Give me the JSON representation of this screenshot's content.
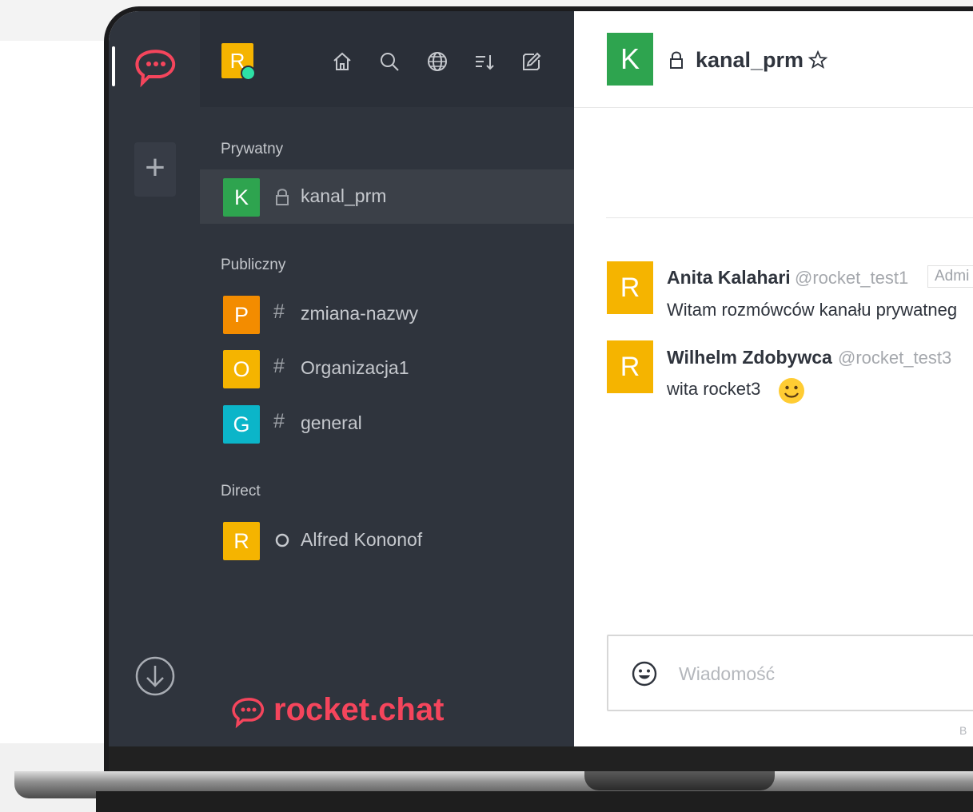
{
  "sidebar": {
    "avatar_letter": "R",
    "sections": {
      "private": "Prywatny",
      "public": "Publiczny",
      "direct": "Direct"
    },
    "rooms": [
      {
        "letter": "K",
        "prefix_icon": "lock-icon",
        "name": "kanal_prm",
        "color": "#2ea44f",
        "active": true
      },
      {
        "letter": "P",
        "prefix_icon": "hash-icon",
        "name": "zmiana-nazwy",
        "color": "#f38c00"
      },
      {
        "letter": "O",
        "prefix_icon": "hash-icon",
        "name": "Organizacja1",
        "color": "#f5b400"
      },
      {
        "letter": "G",
        "prefix_icon": "hash-icon",
        "name": "general",
        "color": "#0bb5c9"
      },
      {
        "letter": "R",
        "prefix_icon": "status-offline-icon",
        "name": "Alfred Kononof",
        "color": "#f5b400"
      }
    ],
    "brand": "rocket.chat"
  },
  "header": {
    "room_letter": "K",
    "room_name": "kanal_prm"
  },
  "messages": [
    {
      "avatar": "R",
      "author": "Anita Kalahari",
      "username": "@rocket_test1",
      "tag": "Admi",
      "text": "Witam rozmówców kanału prywatneg"
    },
    {
      "avatar": "R",
      "author": "Wilhelm Zdobywca",
      "username": "@rocket_test3",
      "text": "wita rocket3"
    }
  ],
  "composer": {
    "placeholder": "Wiadomość",
    "hint": "B"
  },
  "colors": {
    "brand": "#f5455c",
    "sidebar_bg": "#2f343d"
  }
}
